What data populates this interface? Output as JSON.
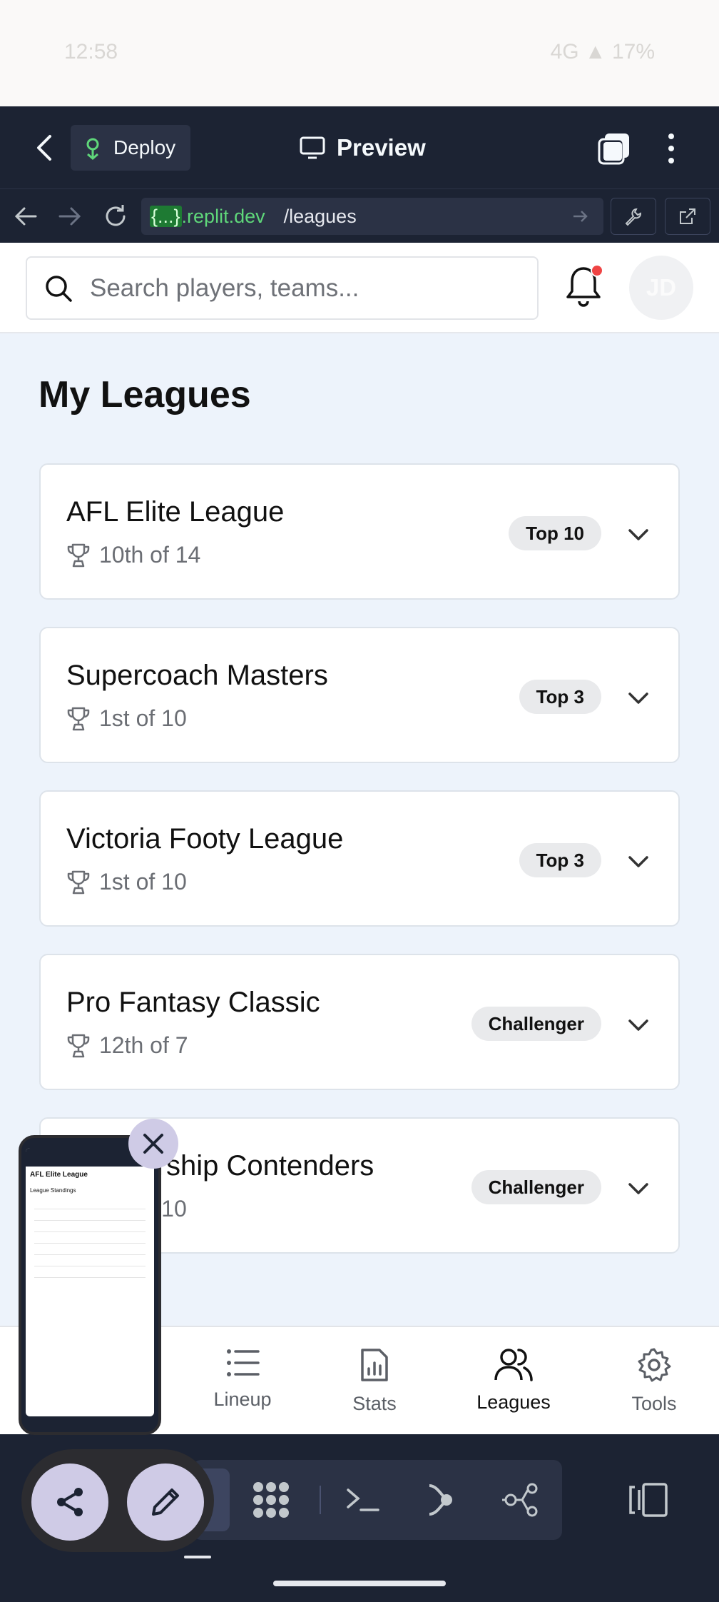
{
  "status_bar": {
    "time": "12:58",
    "right": "4G ▲ 17%"
  },
  "replit": {
    "deploy_label": "Deploy",
    "preview_label": "Preview",
    "url_host": ".replit.dev",
    "url_host_brace": "{...}",
    "url_path": "/leagues"
  },
  "header": {
    "search_placeholder": "Search players, teams...",
    "avatar_initials": "JD"
  },
  "page": {
    "title": "My Leagues"
  },
  "leagues": [
    {
      "name": "AFL Elite League",
      "rank": "10th of 14",
      "badge": "Top 10"
    },
    {
      "name": "Supercoach Masters",
      "rank": "1st of 10",
      "badge": "Top 3"
    },
    {
      "name": "Victoria Footy League",
      "rank": "1st of 10",
      "badge": "Top 3"
    },
    {
      "name": "Pro Fantasy Classic",
      "rank": "12th of 7",
      "badge": "Challenger"
    },
    {
      "name": "Premiership Contenders",
      "rank": "1st of 10",
      "badge": "Challenger"
    }
  ],
  "nav": {
    "lineup": "Lineup",
    "stats": "Stats",
    "leagues": "Leagues",
    "tools": "Tools"
  },
  "pip": {
    "title": "AFL Elite League",
    "subtitle": "League Standings"
  },
  "colors": {
    "accent_dark": "#1c2333",
    "bg": "#edf3fb",
    "badge_bg": "#e9eaec",
    "notify": "#ef4444"
  }
}
